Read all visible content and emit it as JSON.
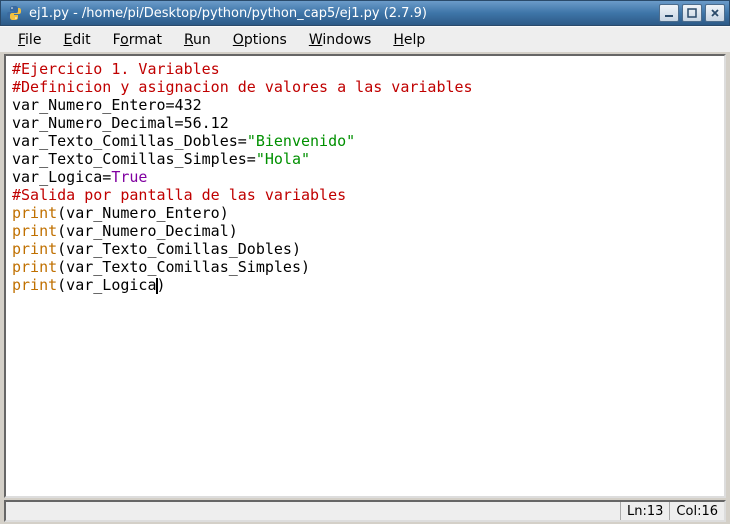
{
  "title": "ej1.py - /home/pi/Desktop/python/python_cap5/ej1.py (2.7.9)",
  "menu": {
    "file": {
      "pre": "",
      "u": "F",
      "post": "ile"
    },
    "edit": {
      "pre": "",
      "u": "E",
      "post": "dit"
    },
    "format": {
      "pre": "F",
      "u": "o",
      "post": "rmat"
    },
    "run": {
      "pre": "",
      "u": "R",
      "post": "un"
    },
    "options": {
      "pre": "",
      "u": "O",
      "post": "ptions"
    },
    "windows": {
      "pre": "",
      "u": "W",
      "post": "indows"
    },
    "help": {
      "pre": "",
      "u": "H",
      "post": "elp"
    }
  },
  "code": {
    "l1": "#Ejercicio 1. Variables",
    "l2": "#Definicion y asignacion de valores a las variables",
    "l3a": "var_Numero_Entero=432",
    "l4a": "var_Numero_Decimal=56.12",
    "l5a": "var_Texto_Comillas_Dobles=",
    "l5b": "\"Bienvenido\"",
    "l6a": "var_Texto_Comillas_Simples=",
    "l6b": "\"Hola\"",
    "l7a": "var_Logica=",
    "l7b": "True",
    "l8": "#Salida por pantalla de las variables",
    "l9a": "print",
    "l9b": "(var_Numero_Entero)",
    "l10a": "print",
    "l10b": "(var_Numero_Decimal)",
    "l11a": "print",
    "l11b": "(var_Texto_Comillas_Dobles)",
    "l12a": "print",
    "l12b": "(var_Texto_Comillas_Simples)",
    "l13a": "print",
    "l13b_pre": "(var_Logica",
    "l13b_post": ")"
  },
  "status": {
    "ln_label": "Ln: ",
    "ln_value": "13",
    "col_label": "Col: ",
    "col_value": "16"
  }
}
